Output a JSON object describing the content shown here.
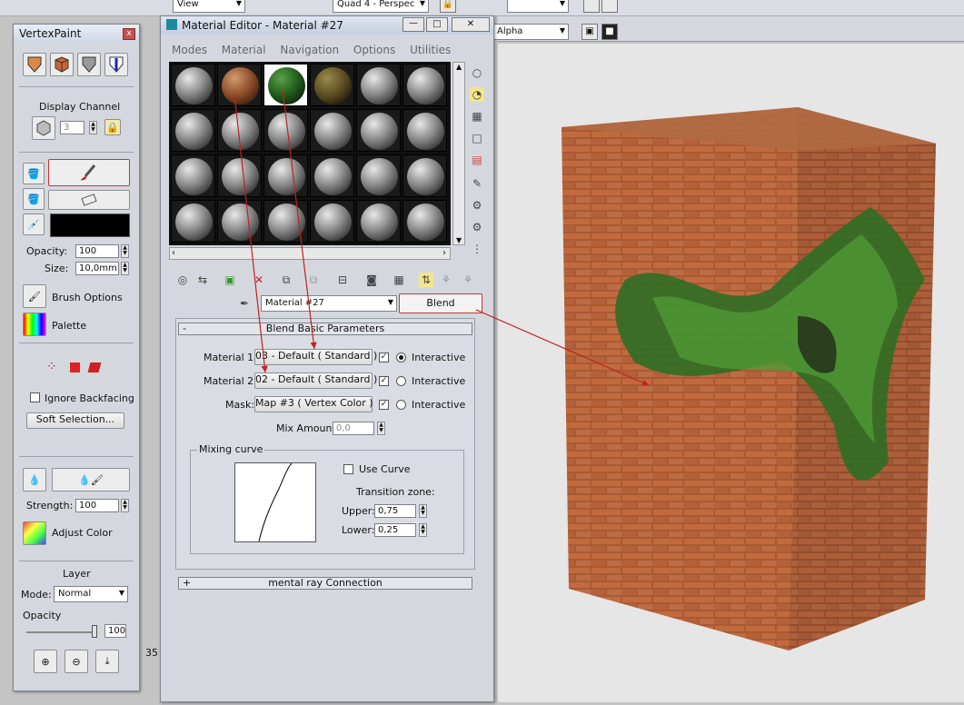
{
  "top": {
    "view_label": "View",
    "viewport_label": "Quad 4 - Perspec",
    "alpha_label": "Alpha",
    "num_label": "35"
  },
  "vertexpaint": {
    "title": "VertexPaint",
    "close": "x",
    "display_channel": "Display Channel",
    "channel_value": "3",
    "opacity_label": "Opacity:",
    "opacity_value": "100",
    "size_label": "Size:",
    "size_value": "10,0mm",
    "brush_options": "Brush Options",
    "palette": "Palette",
    "ignore_backfacing": "Ignore Backfacing",
    "soft_selection": "Soft Selection...",
    "strength_label": "Strength:",
    "strength_value": "100",
    "adjust_color": "Adjust Color",
    "layer_title": "Layer",
    "mode_label": "Mode:",
    "mode_value": "Normal",
    "layer_opacity_label": "Opacity",
    "layer_opacity_value": "100",
    "paint_color": "#000000",
    "accent": "#cc3333"
  },
  "material_editor": {
    "title": "Material Editor - Material #27",
    "menu": [
      "Modes",
      "Material",
      "Navigation",
      "Options",
      "Utilities"
    ],
    "material_name": "Material #27",
    "type_button": "Blend",
    "rollout_blend": "Blend Basic Parameters",
    "mat1_label": "Material 1:",
    "mat1_value": "03 - Default  ( Standard )",
    "mat2_label": "Material 2:",
    "mat2_value": "02 - Default  ( Standard )",
    "mask_label": "Mask:",
    "mask_value": "Map #3  ( Vertex Color )",
    "interactive": "Interactive",
    "mix_amount_label": "Mix Amount:",
    "mix_amount_value": "0,0",
    "mixing_curve": "Mixing curve",
    "use_curve": "Use Curve",
    "transition_zone": "Transition zone:",
    "upper_label": "Upper:",
    "upper_value": "0,75",
    "lower_label": "Lower:",
    "lower_value": "0,25",
    "rollout_mental_ray": "mental ray Connection",
    "minus": "-",
    "plus": "+"
  }
}
